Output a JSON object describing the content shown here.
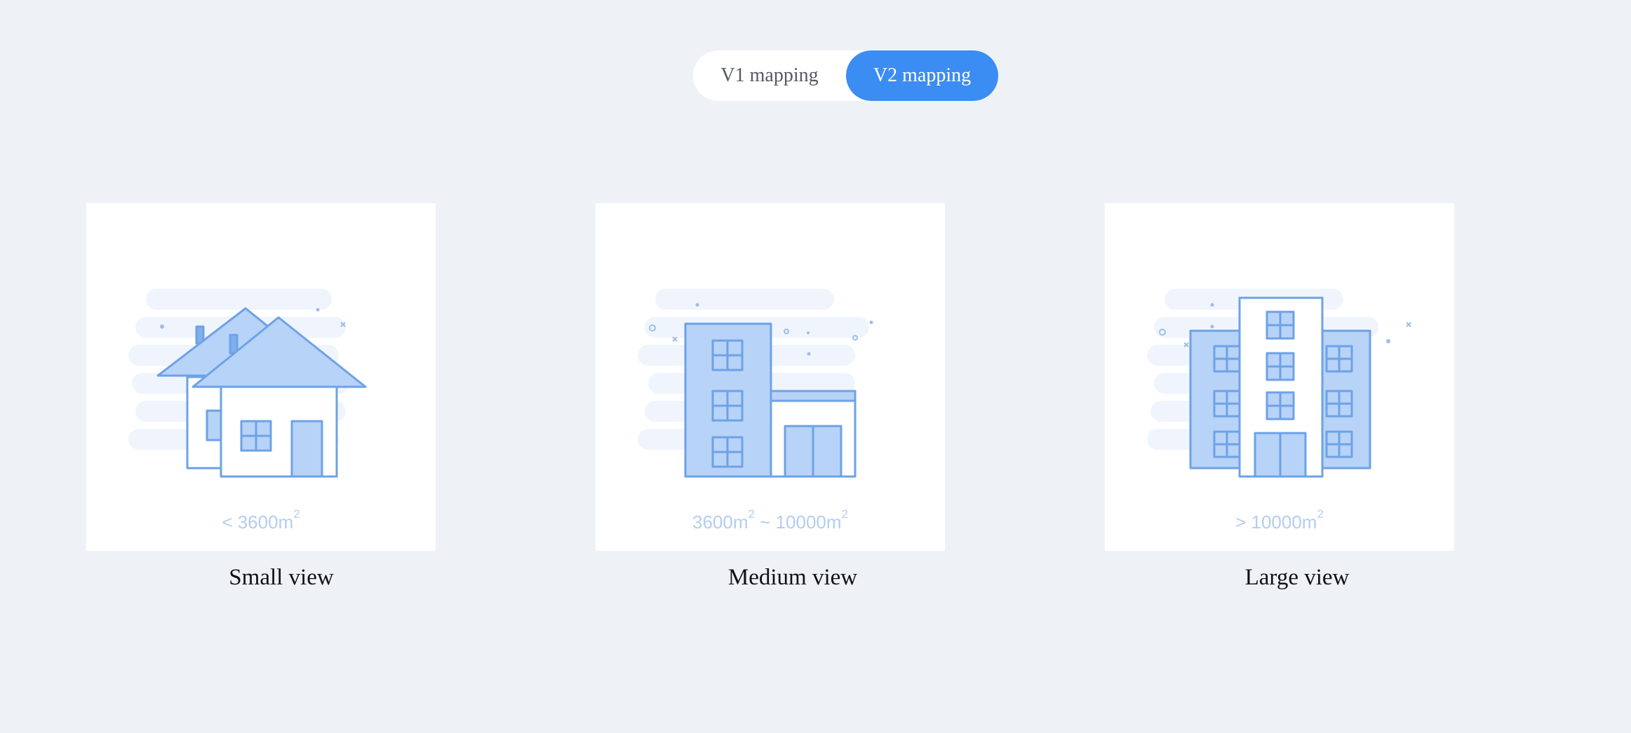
{
  "toggle": {
    "v1_label": "V1 mapping",
    "v2_label": "V2 mapping",
    "selected": "V2 mapping"
  },
  "views": [
    {
      "caption": "Small view",
      "area_prefix": "< 3600m",
      "area_exp": "2",
      "area_suffix": "",
      "area_exp2": ""
    },
    {
      "caption": "Medium view",
      "area_prefix": "3600m",
      "area_exp": "2",
      "area_suffix": " ~ 10000m",
      "area_exp2": "2"
    },
    {
      "caption": "Large view",
      "area_prefix": "> 10000m",
      "area_exp": "2",
      "area_suffix": "",
      "area_exp2": ""
    }
  ],
  "colors": {
    "background": "#eef2f7",
    "accent": "#3b8cf3",
    "illustration_stroke": "#6ea2e6",
    "illustration_fill": "#b7d3f8",
    "cloud": "#f0f5fd"
  }
}
